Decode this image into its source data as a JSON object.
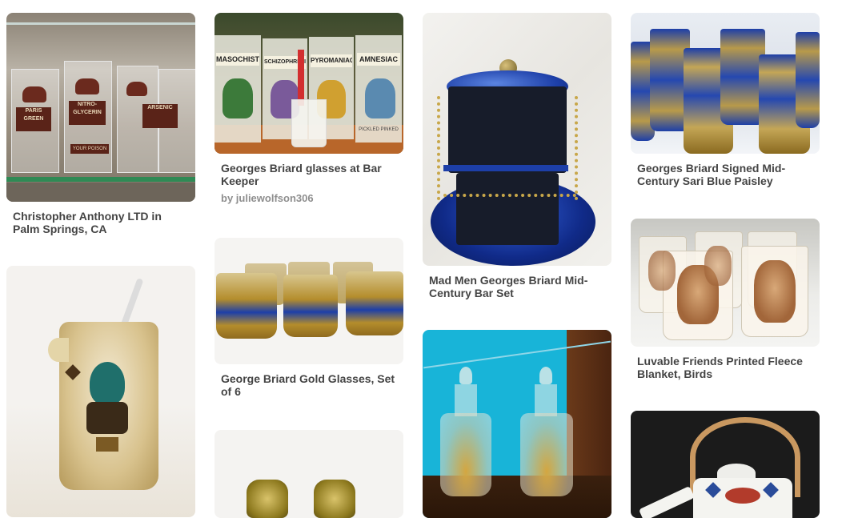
{
  "pins": {
    "cabinet": {
      "caption": "Christopher Anthony LTD in Palm Springs, CA",
      "labels": [
        "PARIS GREEN",
        "NITRO-GLYCERIN",
        "ARSENIC",
        "YOUR POISON"
      ]
    },
    "bar_keeper": {
      "caption": "Georges Briard glasses at Bar Keeper",
      "byline": "by juliewolfson306",
      "labels": [
        "MASOCHIST",
        "SCHIZOPHRENIC",
        "PYROMANIAC",
        "AMNESIAC"
      ],
      "footer": "PICKLED PINKED"
    },
    "bar_set": {
      "caption": "Mad Men Georges Briard Mid-Century Bar Set"
    },
    "sari_paisley": {
      "caption": "Georges Briard Signed Mid-Century Sari Blue Paisley"
    },
    "pitcher": {},
    "gold_glasses": {
      "caption": "George Briard Gold Glasses, Set of 6"
    },
    "cruets": {},
    "owls": {
      "caption": "Luvable Friends Printed Fleece Blanket, Birds"
    },
    "gold_candle": {},
    "teapot": {}
  },
  "colors": {
    "caption": "#444444",
    "byline": "#8e8e8e",
    "gold": "#b8902a",
    "blue": "#1d3fa8",
    "teal_wall": "#18b4d8"
  }
}
